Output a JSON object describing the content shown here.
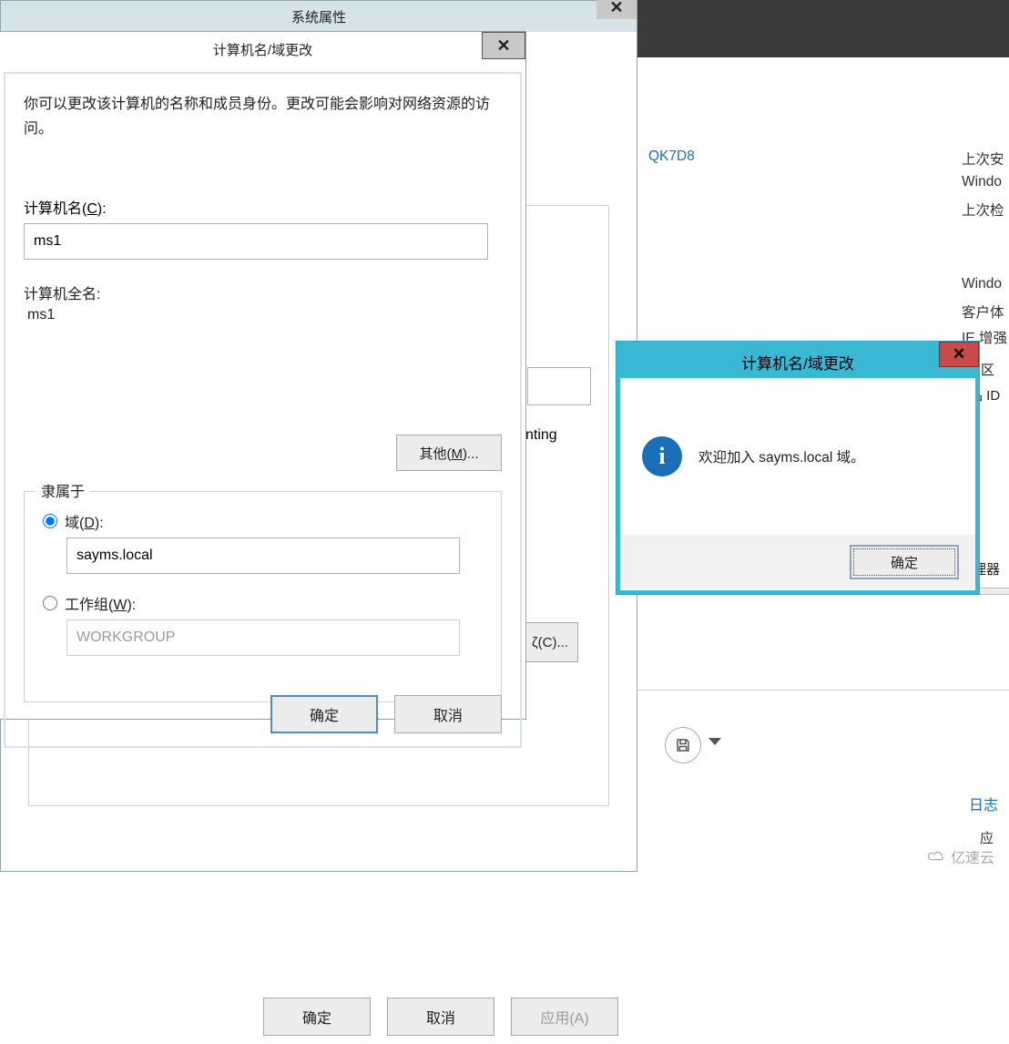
{
  "sysprops": {
    "title": "系统属性",
    "partial_text": "nting",
    "partial_btn": "ζ(C)...",
    "ok": "确定",
    "cancel": "取消",
    "apply": "应用(A)"
  },
  "change": {
    "title": "计算机名/域更改",
    "info": "你可以更改该计算机的名称和成员身份。更改可能会影响对网络资源的访问。",
    "computer_name_label": "计算机名(C):",
    "computer_name_value": "ms1",
    "full_name_label": "计算机全名:",
    "full_name_value": "ms1",
    "more_btn": "其他(M)...",
    "member_legend": "隶属于",
    "domain_label": "域(D):",
    "domain_value": "sayms.local",
    "workgroup_label": "工作组(W):",
    "workgroup_value": "WORKGROUP",
    "ok": "确定",
    "cancel": "取消"
  },
  "msgbox": {
    "title": "计算机名/域更改",
    "message": "欢迎加入 sayms.local 域。",
    "ok": "确定"
  },
  "background": {
    "hostid": "QK7D8",
    "labels": {
      "last_install": "上次安",
      "windows": "Windo",
      "last_check": "上次检",
      "windows2": "Windo",
      "customer": "客户体",
      "ie_enh": "IE 增强",
      "zone": "区",
      "prodid": "品 ID",
      "proc": "理器"
    },
    "log": "日志",
    "app": "应",
    "watermark": "亿速云"
  }
}
